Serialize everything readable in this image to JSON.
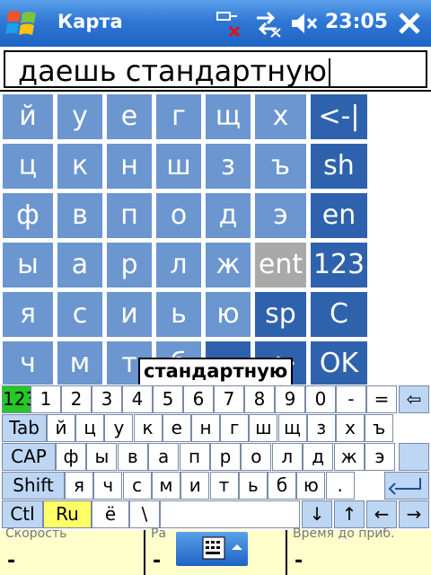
{
  "titlebar": {
    "app_title": "Карта",
    "clock": "23:05",
    "icons": [
      "start-menu-icon",
      "network-disconnected-icon",
      "connectivity-icon",
      "volume-muted-icon",
      "close-icon"
    ]
  },
  "textbox": {
    "value": "даешь стандартную"
  },
  "big_keyboard": {
    "rows": [
      [
        "й",
        "у",
        "е",
        "г",
        "щ",
        "х",
        "<-|"
      ],
      [
        "ц",
        "к",
        "н",
        "ш",
        "з",
        "ъ",
        "sh"
      ],
      [
        "ф",
        "в",
        "п",
        "о",
        "д",
        "э",
        "en"
      ],
      [
        "ы",
        "а",
        "р",
        "л",
        "ж",
        "ent",
        "123"
      ],
      [
        "я",
        "с",
        "и",
        "ь",
        "ю",
        "sp",
        "C"
      ],
      [
        "ч",
        "м",
        "т",
        "б",
        "←",
        "->",
        "OK"
      ]
    ]
  },
  "suggestion": "стандартную",
  "soft_keyboard": {
    "row1": [
      "123",
      "1",
      "2",
      "3",
      "4",
      "5",
      "6",
      "7",
      "8",
      "9",
      "0",
      "-",
      "=",
      "⇦"
    ],
    "row2": [
      "Tab",
      "й",
      "ц",
      "у",
      "к",
      "е",
      "н",
      "г",
      "ш",
      "щ",
      "з",
      "х",
      "ъ"
    ],
    "row3": [
      "CAP",
      "ф",
      "ы",
      "в",
      "а",
      "п",
      "р",
      "о",
      "л",
      "д",
      "ж",
      "э"
    ],
    "row4": [
      "Shift",
      "я",
      "ч",
      "с",
      "м",
      "и",
      "т",
      "ь",
      "б",
      "ю",
      "."
    ],
    "row5": [
      "Ctl",
      "Ru",
      "ё",
      "\\",
      "",
      "↓",
      "↑",
      "←",
      "→"
    ]
  },
  "statusbar": {
    "cell1_label": "Скорость",
    "cell1_value": "-",
    "cell2_label": "Ра",
    "cell2_value": "-",
    "cell3_label": "Время до приб.",
    "cell3_value": "-"
  },
  "colors": {
    "title_bar": "#2f78d6",
    "key_blue": "#6b96cf",
    "key_dark": "#2f62ad",
    "key_gray": "#a9a9a9",
    "status_bg": "#ffffcc"
  }
}
